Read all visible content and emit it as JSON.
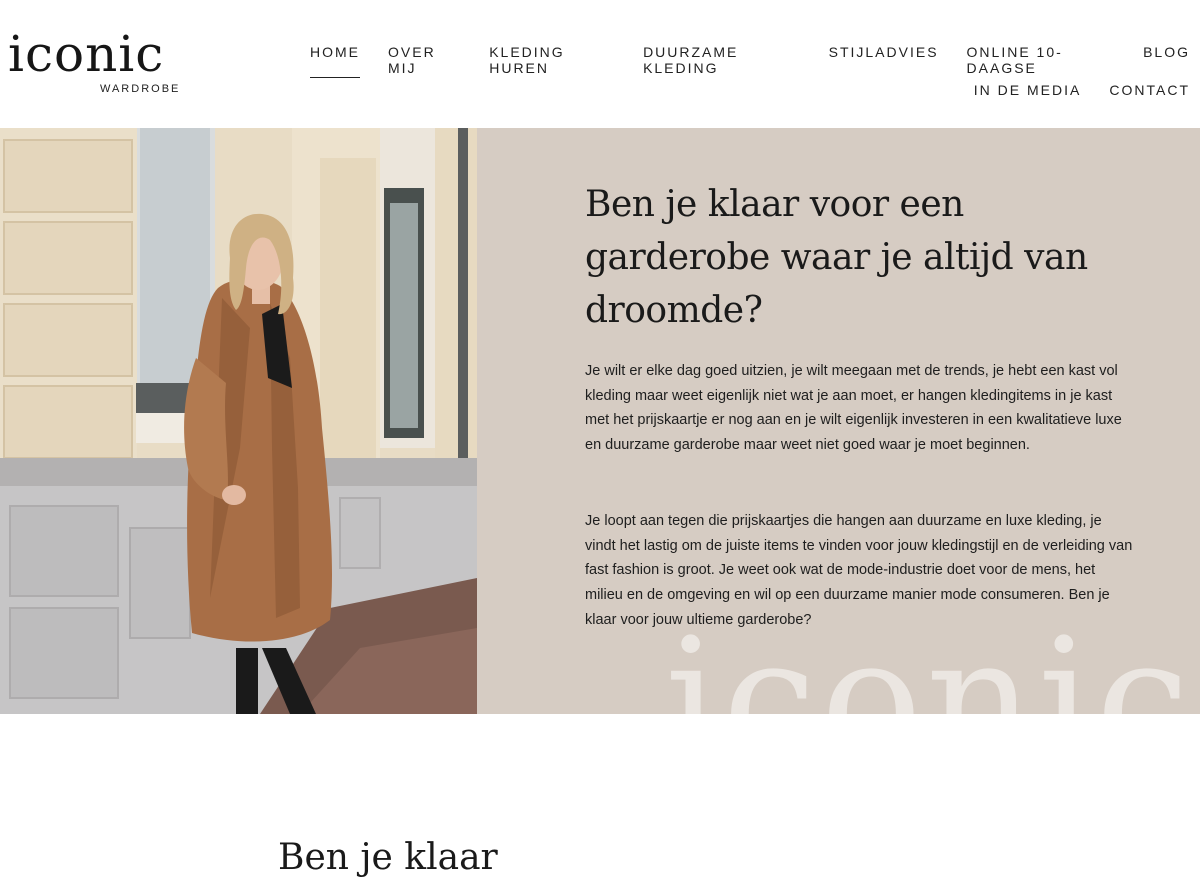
{
  "brand": {
    "logo_word": "iconic",
    "logo_sub": "WARDROBE"
  },
  "nav": {
    "row1": [
      "HOME",
      "OVER MIJ",
      "KLEDING HUREN",
      "DUURZAME KLEDING",
      "STIJLADVIES",
      "ONLINE 10-DAAGSE",
      "BLOG"
    ],
    "row2": [
      "IN DE MEDIA",
      "CONTACT"
    ],
    "active": "HOME"
  },
  "hero": {
    "title": "Ben je klaar voor een garderobe waar je altijd van droomde?",
    "paragraph1": "Je wilt er elke dag goed uitzien, je wilt meegaan met de trends, je hebt een kast vol kleding maar weet eigenlijk niet wat je aan moet, er hangen kledingitems in je kast met het prijskaartje er nog aan en je wilt eigenlijk investeren in een kwalitatieve luxe en duurzame garderobe maar weet niet goed waar je moet beginnen.",
    "paragraph2": "Je loopt aan tegen die prijskaartjes die hangen aan duurzame en luxe kleding, je vindt het lastig om de juiste items te vinden voor jouw kledingstijl en de verleiding van fast fashion is groot. Je weet ook wat de mode-industrie doet voor de mens, het milieu en de omgeving en wil op een duurzame manier mode consumeren. Ben je klaar voor jouw ultieme garderobe?",
    "watermark": "iconic"
  },
  "below": {
    "heading": "Ben je klaar"
  },
  "colors": {
    "panel": "#d6ccc3",
    "text": "#1a1a1a",
    "watermark": "#ebe6e1",
    "coat": "#a86e46"
  }
}
